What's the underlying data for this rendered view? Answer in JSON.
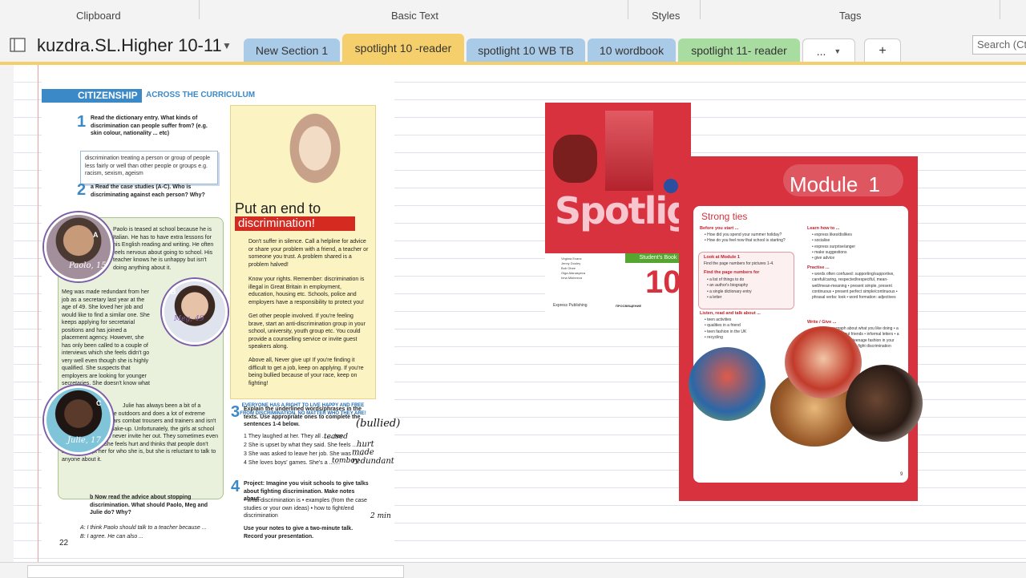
{
  "ribbon": {
    "groups": [
      "Clipboard",
      "Basic Text",
      "Styles",
      "Tags"
    ]
  },
  "notebook": {
    "name": "kuzdra.SL.Higher 10-11",
    "caret_icon": "chevron-down-icon"
  },
  "tabs": [
    {
      "label": "New Section 1",
      "color": "#aacbe8"
    },
    {
      "label": "spotlight 10 -reader",
      "color": "#f5cf6b",
      "active": true
    },
    {
      "label": "spotlight 10 WB TB",
      "color": "#aacbe8"
    },
    {
      "label": "10 wordbook",
      "color": "#aacbe8"
    },
    {
      "label": "spotlight 11- reader",
      "color": "#a8dca0"
    },
    {
      "label": "...",
      "color": "#ffffff"
    },
    {
      "label": "+",
      "color": "#ffffff"
    }
  ],
  "search": {
    "placeholder": "Search (Ctr"
  },
  "book": {
    "section_title": "CITIZENSHIP",
    "section_sub": "ACROSS THE CURRICULUM",
    "task1_num": "1",
    "task1_text": "Read the dictionary entry. What kinds of discrimination can people suffer from? (e.g. skin colour, nationality ... etc)",
    "definition": "discrimination treating a person or group of people less fairly or well than other people or groups e.g. racism, sexism, ageism",
    "task2_num": "2",
    "task2_text": "a  Read the case studies (A-C). Who is discriminating against each person? Why?",
    "paolo_text": "Paolo is teased at school because he is Italian. He has to have extra lessons for his English reading and writing. He often feels nervous about going to school. His teacher knows he is unhappy but isn't doing anything about it.",
    "meg_text": "Meg was made redundant from her job as a secretary last year at the age of 49. She loved her job and would like to find a similar one. She keeps applying for secretarial positions and has joined a placement agency. However, she has only been called to a couple of interviews which she feels didn't go very well even though she is highly qualified. She suspects that employers are looking for younger secretaries. She doesn't know what to do.",
    "julie_text": "Julie has always been a bit of a tomboy. She loves the outdoors and does a lot of extreme sports. She often wears combat trousers and trainers and isn't keen on fashion or make-up. Unfortunately, the girls at school don't talk to her and never invite her out. They sometimes even make fun of her. She feels hurt and thinks that people don't always accept her for who she is, but she is reluctant to talk to anyone about it.",
    "label_a": "A",
    "label_b": "B",
    "label_c": "C",
    "sig_paolo": "Paolo, 15",
    "sig_meg": "Meg, 49",
    "sig_julie": "Julie, 17",
    "put_an_end": "Put an end to",
    "discrimination": "discrimination!",
    "advice1": "Don't suffer in silence. Call a helpline for advice or share your problem with a friend, a teacher or someone you trust. A problem shared is a problem halved!",
    "advice2": "Know your rights. Remember: discrimination is illegal in Great Britain in employment, education, housing etc. Schools, police and employers have a responsibility to protect you!",
    "advice3": "Get other people involved. If you're feeling brave, start an anti-discrimination group in your school, university, youth group etc. You could provide a counselling service or invite guest speakers along.",
    "advice4": "Above all, Never give up! If you're finding it difficult to get a job, keep on applying. If you're being bullied because of your race, keep on fighting!",
    "slogan": "EVERYONE HAS A RIGHT TO LIVE HAPPY AND FREE FROM DISCRIMINATION, NO MATTER WHO THEY ARE!",
    "task3_num": "3",
    "task3_text": "Explain the underlined words/phrases in the texts. Use appropriate ones to complete the sentences 1-4 below.",
    "task3_items": [
      "1  They laughed at her. They all ....... her.",
      "2  She is upset by what they said. She feels .......",
      "3  She was asked to leave her job. She was .......",
      "4  She loves boys' games. She's a ......."
    ],
    "task4_num": "4",
    "task4_text": "Project: Imagine you visit schools to give talks about fighting discrimination. Make notes about:",
    "task4_items": "• what discrimination is  • examples (from the case studies or your own ideas)  • how to fight/end discrimination",
    "task4_end": "Use your notes to give a two-minute talk. Record your presentation.",
    "task2b": "b  Now read the advice about stopping discrimination. What should Paolo, Meg and Julie do? Why?",
    "dialogue_a": "A:  I think Paolo should talk to a teacher because ...",
    "dialogue_b": "B:  I agree. He can also ...",
    "page_num": "22",
    "hand_bullied": "(bullied)",
    "hand_teased": "teased",
    "hand_hurt": "hurt",
    "hand_redundant": "made redundant",
    "hand_tomboy": "tomboy",
    "hand_2min": "2 min"
  },
  "cover": {
    "title": "Spotlight",
    "band": "Student's Book",
    "number": "10",
    "authors": "Virginia Evans\nJenny Dooley\nBob Obee\nOlga Afanasyeva\nIrina Mikheeva",
    "publisher1": "Express Publishing",
    "publisher2": "ПРОСВЕЩЕНИЕ"
  },
  "module": {
    "title": "Module",
    "number": "1",
    "heading": "Strong ties",
    "before_head": "Before you start ...",
    "before_items": "• How did you spend your summer holiday?\n• How do you feel now that school is starting?",
    "look_head": "Look at Module 1",
    "look_item": "Find the page numbers for pictures 1-4.",
    "find_head": "Find the page numbers for",
    "find_items": "• a list of things to do\n• an author's biography\n• a single dictionary entry\n• a letter",
    "listen_head": "Listen, read and talk about ...",
    "listen_items": "• teen activities\n• qualities in a friend\n• teen fashion in the UK\n• recycling",
    "learn_head": "Learn how to ...",
    "learn_items": "• express likes/dislikes\n• socialise\n• express surprise/anger\n• make suggestions\n• give advice",
    "practise_head": "Practise ...",
    "practise_items": "• words often confused: supporting/supportive, careful/caring, respected/respectful, mean-well/mean-meaning\n• present simple, present continuous\n• present perfect simple/continuous\n• phrasal verbs: look\n• word formation: adjectives",
    "write_head": "Write / Give ...",
    "write_items": "• a short paragraph about what you like doing\n• a two-minute talk about friends\n• informal letters\n• a short paragraph about teenage fashion in your country\n• a talk on how to fight discrimination",
    "page_num": "9"
  }
}
